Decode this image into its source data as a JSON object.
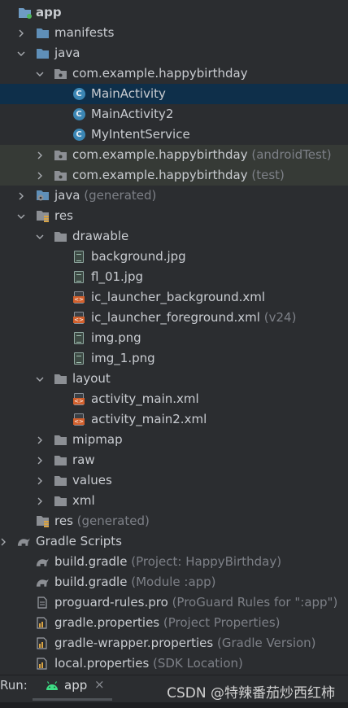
{
  "tree": {
    "app": "app",
    "manifests": "manifests",
    "java": "java",
    "pkg_main": "com.example.happybirthday",
    "main_activity": "MainActivity",
    "main_activity2": "MainActivity2",
    "intent_service": "MyIntentService",
    "pkg_android_test": "com.example.happybirthday",
    "pkg_android_test_tag": "(androidTest)",
    "pkg_test": "com.example.happybirthday",
    "pkg_test_tag": "(test)",
    "java_generated": "java",
    "java_generated_tag": "(generated)",
    "res": "res",
    "drawable": "drawable",
    "background_jpg": "background.jpg",
    "fl_01_jpg": "fl_01.jpg",
    "ic_launcher_background": "ic_launcher_background.xml",
    "ic_launcher_foreground": "ic_launcher_foreground.xml",
    "ic_launcher_foreground_tag": "(v24)",
    "img_png": "img.png",
    "img_1_png": "img_1.png",
    "layout": "layout",
    "activity_main": "activity_main.xml",
    "activity_main2": "activity_main2.xml",
    "mipmap": "mipmap",
    "raw": "raw",
    "values": "values",
    "xml": "xml",
    "res_generated": "res",
    "res_generated_tag": "(generated)",
    "gradle_scripts": "Gradle Scripts",
    "build_gradle_project": "build.gradle",
    "build_gradle_project_tag": "(Project: HappyBirthday)",
    "build_gradle_module": "build.gradle",
    "build_gradle_module_tag": "(Module :app)",
    "proguard": "proguard-rules.pro",
    "proguard_tag": "(ProGuard Rules for \":app\")",
    "gradle_properties": "gradle.properties",
    "gradle_properties_tag": "(Project Properties)",
    "gradle_wrapper": "gradle-wrapper.properties",
    "gradle_wrapper_tag": "(Gradle Version)",
    "local_properties": "local.properties",
    "local_properties_tag": "(SDK Location)"
  },
  "run_bar": {
    "label": "Run:",
    "tab_label": "app",
    "close": "×"
  },
  "watermark": "CSDN @特辣番茄炒西红柿",
  "colors": {
    "background": "#2b2d30",
    "selection": "#0e2f4a",
    "test_highlight": "#363a36",
    "folder_blue": "#5f8fb8",
    "class_icon": "#3b86b4",
    "xml_orange": "#d2602d",
    "muted_text": "#7d8087"
  },
  "icons": [
    "chevron-down-icon",
    "chevron-right-icon",
    "folder-icon",
    "package-icon",
    "class-icon",
    "image-file-icon",
    "xml-file-icon",
    "gradle-icon",
    "properties-icon",
    "android-icon",
    "close-icon"
  ]
}
